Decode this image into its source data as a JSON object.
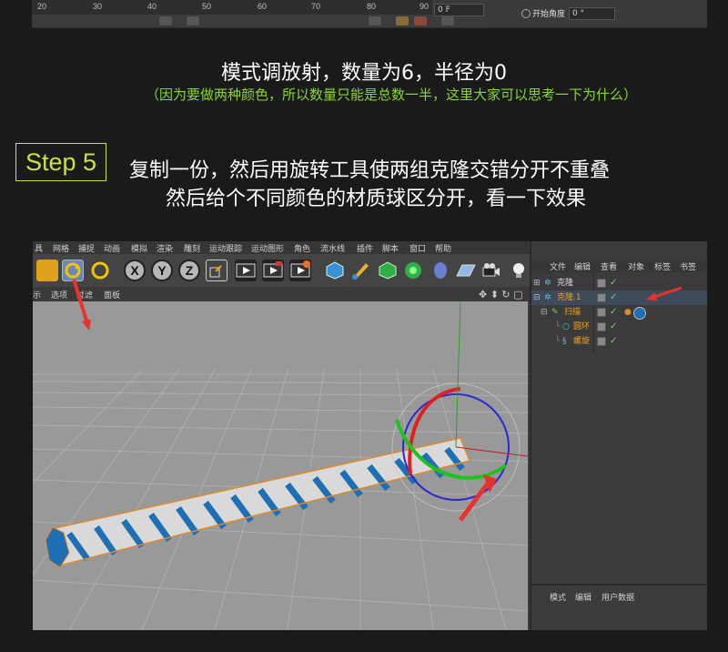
{
  "top_strip": {
    "ruler_ticks": [
      "20",
      "30",
      "40",
      "50",
      "60",
      "70",
      "80",
      "90"
    ],
    "frame_field": "0 F",
    "start_angle_label": "开始角度",
    "start_angle_value": "0 °"
  },
  "captions": {
    "line1": "模式调放射，数量为6，半径为0",
    "line2": "（因为要做两种颜色，所以数量只能是总数一半，这里大家可以思考一下为什么）",
    "step_label": "Step 5",
    "line3": "复制一份，然后用旋转工具使两组克隆交错分开不重叠",
    "line4": "然后给个不同颜色的材质球区分开，看一下效果"
  },
  "app": {
    "menu": [
      "具",
      "网格",
      "捕捉",
      "动画",
      "模拟",
      "渲染",
      "雕刻",
      "运动跟踪",
      "运动图形",
      "角色",
      "流水线",
      "插件",
      "脚本",
      "窗口",
      "帮助"
    ],
    "toolbar_axes": [
      "X",
      "Y",
      "Z"
    ],
    "view_menu": [
      "示",
      "选项",
      "过滤",
      "面板"
    ],
    "object_manager": {
      "menu": [
        "文件",
        "编辑",
        "查看",
        "对象",
        "标签",
        "书签"
      ],
      "objects": [
        {
          "name": "克隆"
        },
        {
          "name": "克隆.1"
        },
        {
          "name": "扫描"
        },
        {
          "name": "圆环"
        },
        {
          "name": "螺旋"
        }
      ],
      "attr_menu": [
        "模式",
        "编辑",
        "用户数据"
      ]
    }
  },
  "colors": {
    "accent_green": "#8bd62e",
    "step_yellow": "#c8e34a",
    "rope_blue": "#1f6fb5",
    "rope_white": "#d9d9d9",
    "selection_orange": "#e08a2a",
    "annotation_red": "#e8322c"
  }
}
